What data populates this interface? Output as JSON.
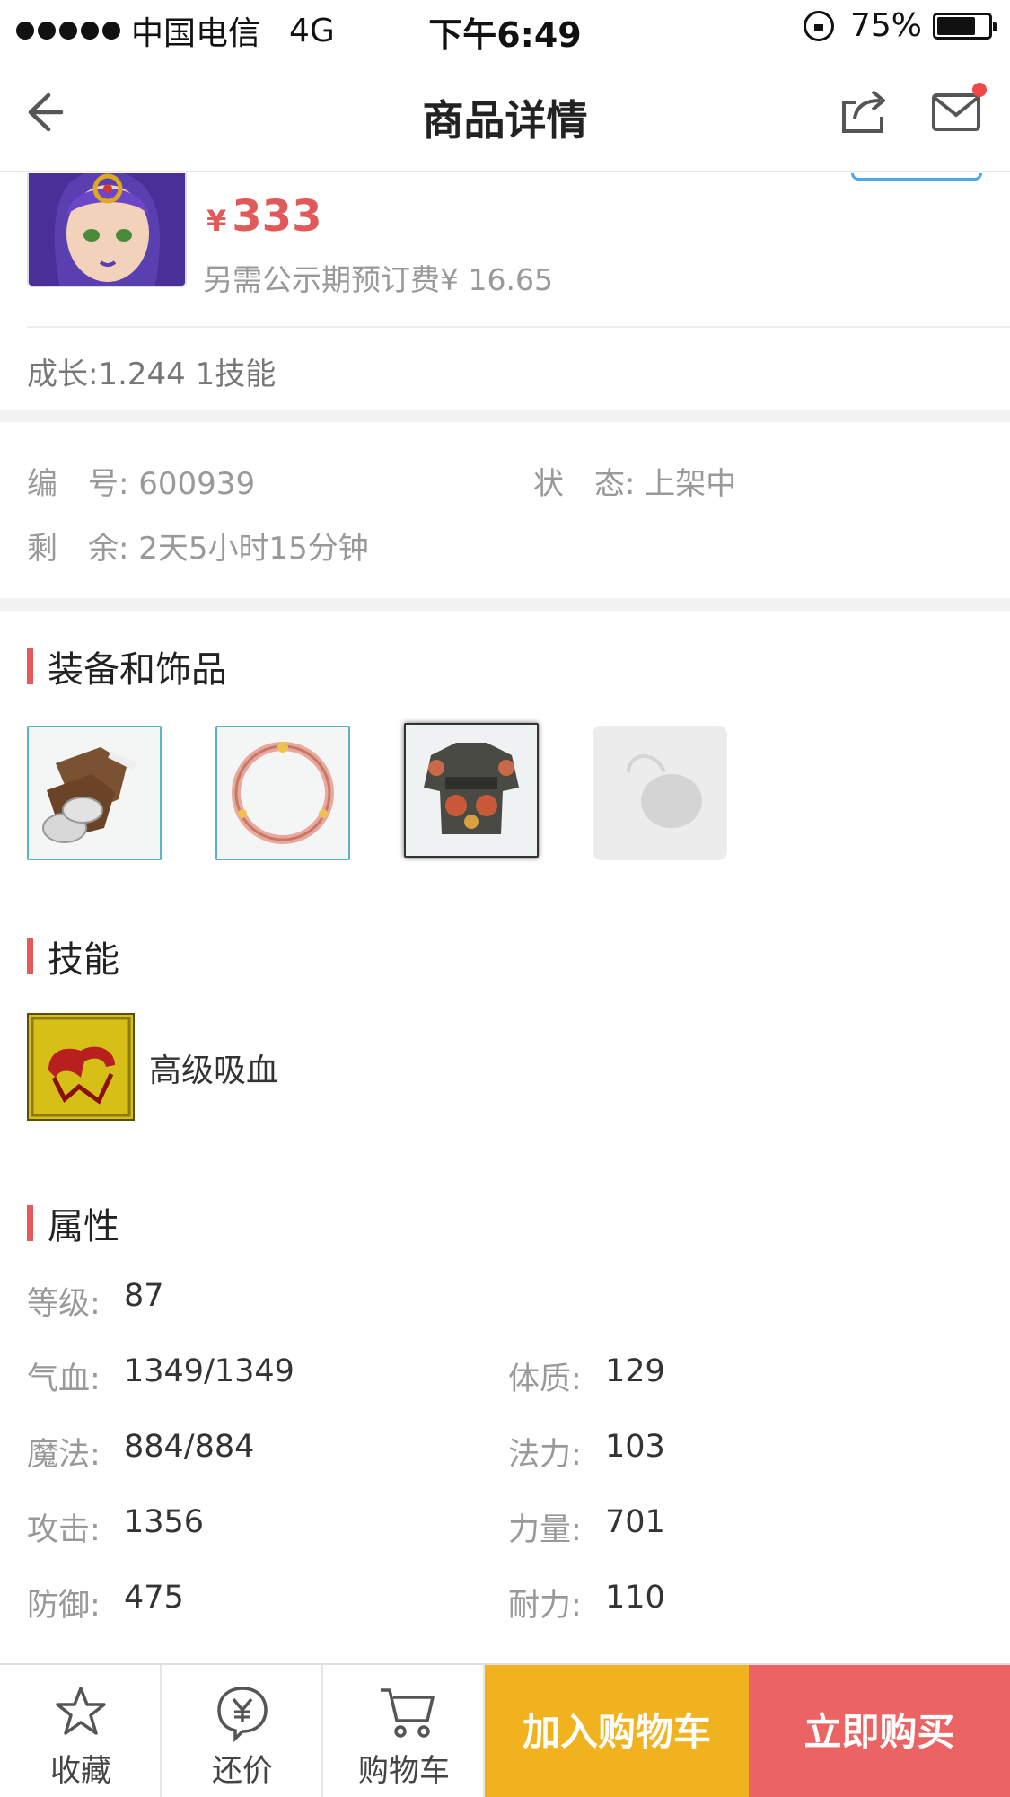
{
  "status_bar": {
    "carrier": "中国电信",
    "network": "4G",
    "time": "下午6:49",
    "battery_text": "75%",
    "battery_level": 0.75
  },
  "header": {
    "title": "商品详情",
    "back_icon": "back-arrow-icon",
    "share_icon": "share-icon",
    "mail_icon": "mail-icon",
    "notification_dot_color": "#f04848"
  },
  "product": {
    "currency": "¥",
    "price": "333",
    "extra_fee": "另需公示期预订费¥ 16.65",
    "growth": "成长:1.244 1技能"
  },
  "info": {
    "id_label": "编　号:",
    "id_value": "600939",
    "status_label": "状　态:",
    "status_value": "上架中",
    "remaining_label": "剩　余:",
    "remaining_value": "2天5小时15分钟"
  },
  "sections": {
    "equipment_title": "装备和饰品",
    "skills_title": "技能",
    "attributes_title": "属性"
  },
  "equipment": [
    {
      "icon": "boots-icon"
    },
    {
      "icon": "ring-icon"
    },
    {
      "icon": "armor-icon"
    },
    {
      "icon": "empty-accessory-slot-icon"
    }
  ],
  "skills": [
    {
      "name": "高级吸血",
      "icon": "blood-sucking-skill-icon"
    }
  ],
  "attributes": {
    "level": {
      "label": "等级:",
      "value": "87"
    },
    "hp": {
      "label": "气血:",
      "value": "1349/1349"
    },
    "constitution": {
      "label": "体质:",
      "value": "129"
    },
    "mp": {
      "label": "魔法:",
      "value": "884/884"
    },
    "magic_power": {
      "label": "法力:",
      "value": "103"
    },
    "attack": {
      "label": "攻击:",
      "value": "1356"
    },
    "strength": {
      "label": "力量:",
      "value": "701"
    },
    "defense": {
      "label": "防御:",
      "value": "475"
    },
    "endurance": {
      "label": "耐力:",
      "value": "110"
    }
  },
  "bottom_bar": {
    "favorite": "收藏",
    "bargain": "还价",
    "cart": "购物车",
    "add_to_cart": "加入购物车",
    "buy_now": "立即购买",
    "add_to_cart_color": "#f0b21e",
    "buy_now_color": "#ec6363"
  },
  "colors": {
    "accent_red": "#e05a5a",
    "section_bar": "#e85a5a"
  }
}
